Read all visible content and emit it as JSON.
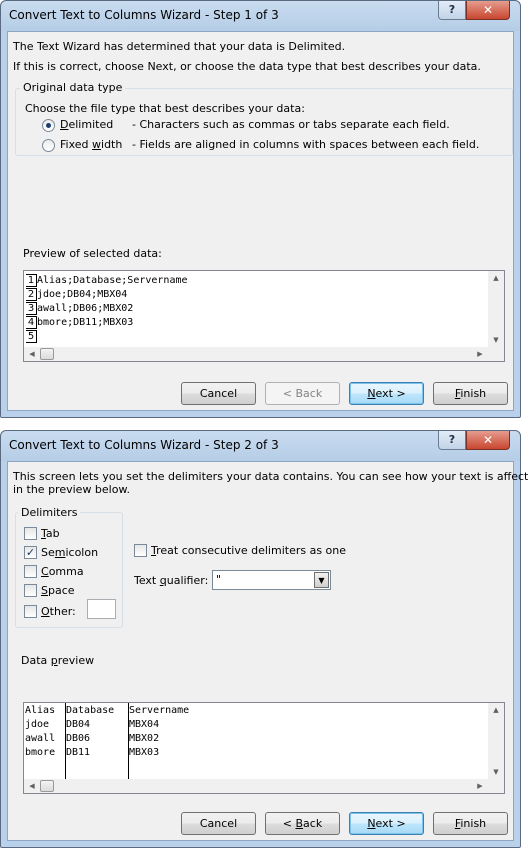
{
  "dialog1": {
    "title": "Convert Text to Columns Wizard - Step 1 of 3",
    "help_label": "?",
    "close_label": "✕",
    "intro_line1": "The Text Wizard has determined that your data is Delimited.",
    "intro_line2": "If this is correct, choose Next, or choose the data type that best describes your data.",
    "group_label": "Original data type",
    "group_prompt": "Choose the file type that best describes your data:",
    "options": [
      {
        "label": "Delimited",
        "description": "- Characters such as commas or tabs separate each field.",
        "selected": true
      },
      {
        "label": "Fixed width",
        "description": "- Fields are aligned in columns with spaces between each field.",
        "selected": false
      }
    ],
    "preview_label": "Preview of selected data:",
    "preview_rows": [
      {
        "num": "1",
        "text": "Alias;Database;Servername"
      },
      {
        "num": "2",
        "text": "jdoe;DB04;MBX04"
      },
      {
        "num": "3",
        "text": "awall;DB06;MBX02"
      },
      {
        "num": "4",
        "text": "bmore;DB11;MBX03"
      },
      {
        "num": "5",
        "text": ""
      }
    ],
    "buttons": {
      "cancel": "Cancel",
      "back": "< Back",
      "next": "Next >",
      "finish": "Finish"
    }
  },
  "dialog2": {
    "title": "Convert Text to Columns Wizard - Step 2 of 3",
    "help_label": "?",
    "close_label": "✕",
    "intro_line1": "This screen lets you set the delimiters your data contains.  You can see how your text is affected",
    "intro_line2": "in the preview below.",
    "delimiters_label": "Delimiters",
    "delimiters": [
      {
        "label": "Tab",
        "checked": false
      },
      {
        "label": "Semicolon",
        "checked": true
      },
      {
        "label": "Comma",
        "checked": false
      },
      {
        "label": "Space",
        "checked": false
      },
      {
        "label": "Other:",
        "checked": false
      }
    ],
    "other_value": "",
    "consecutive_label": "Treat consecutive delimiters as one",
    "consecutive_checked": false,
    "qualifier_label": "Text qualifier:",
    "qualifier_value": "\"",
    "preview_label": "Data preview",
    "preview_columns": [
      [
        "Alias",
        "jdoe",
        "awall",
        "bmore"
      ],
      [
        "Database",
        "DB04",
        "DB06",
        "DB11"
      ],
      [
        "Servername",
        "MBX04",
        "MBX02",
        "MBX03"
      ]
    ],
    "buttons": {
      "cancel": "Cancel",
      "back": "< Back",
      "next": "Next >",
      "finish": "Finish"
    }
  }
}
